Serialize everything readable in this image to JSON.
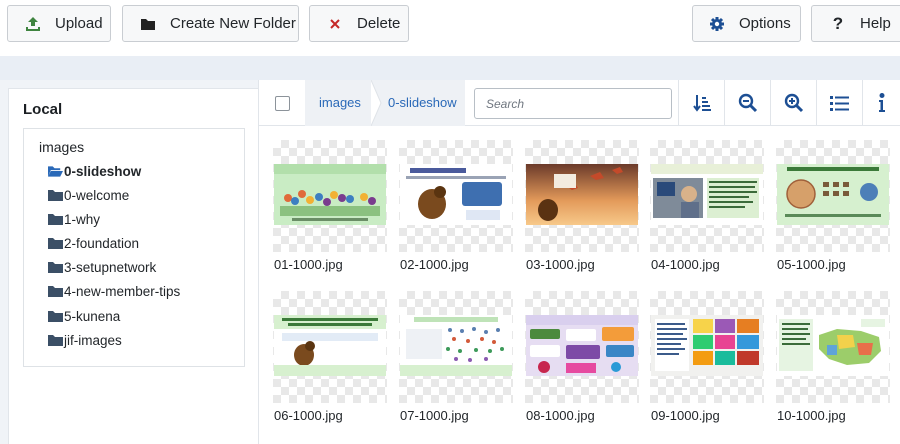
{
  "toolbar": {
    "upload_label": "Upload",
    "create_folder_label": "Create New Folder",
    "delete_label": "Delete",
    "options_label": "Options",
    "help_label": "Help"
  },
  "sidebar": {
    "title": "Local",
    "root": "images",
    "folders": [
      "0-slideshow",
      "0-welcome",
      "1-why",
      "2-foundation",
      "3-setupnetwork",
      "4-new-member-tips",
      "5-kunena",
      "jif-images"
    ],
    "active": "0-slideshow"
  },
  "breadcrumb": [
    "images",
    "0-slideshow"
  ],
  "search": {
    "placeholder": "Search"
  },
  "files": [
    "01-1000.jpg",
    "02-1000.jpg",
    "03-1000.jpg",
    "04-1000.jpg",
    "05-1000.jpg",
    "06-1000.jpg",
    "07-1000.jpg",
    "08-1000.jpg",
    "09-1000.jpg",
    "10-1000.jpg"
  ],
  "colors": {
    "accent": "#2a69b8",
    "folder": "#3b4f66",
    "delete": "#c52827",
    "upload": "#3f8440"
  }
}
